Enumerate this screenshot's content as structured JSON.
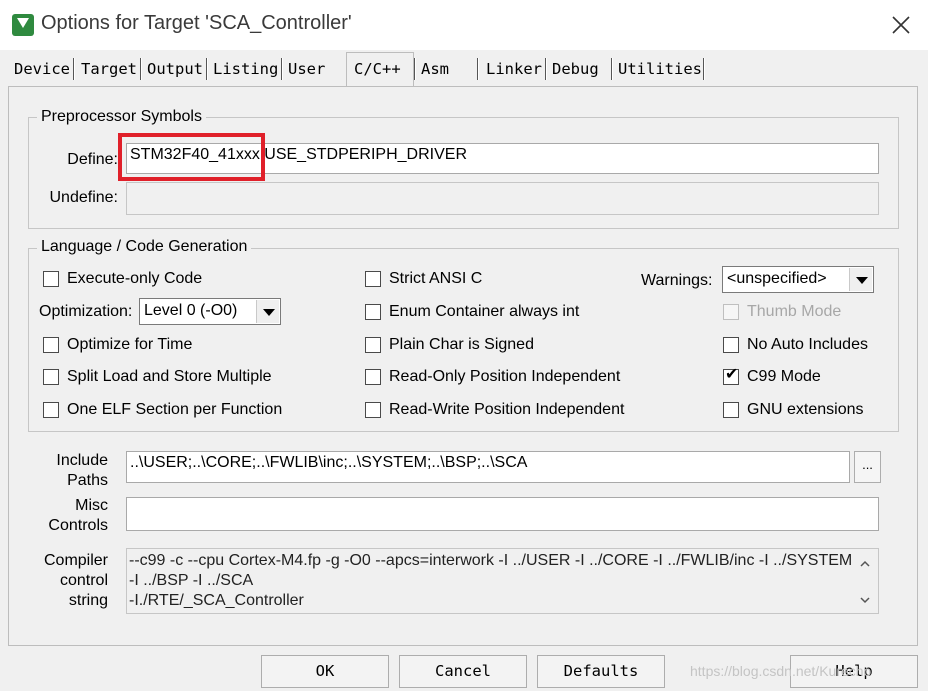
{
  "window": {
    "title": "Options for Target 'SCA_Controller'"
  },
  "tabs": [
    "Device",
    "Target",
    "Output",
    "Listing",
    "User",
    "C/C++",
    "Asm",
    "Linker",
    "Debug",
    "Utilities"
  ],
  "active_tab": "C/C++",
  "preprocessor": {
    "group_title": "Preprocessor Symbols",
    "define_label": "Define:",
    "define_value": "STM32F40_41xxx,USE_STDPERIPH_DRIVER",
    "undefine_label": "Undefine:",
    "undefine_value": ""
  },
  "language": {
    "group_title": "Language / Code Generation",
    "execute_only": {
      "label": "Execute-only Code",
      "checked": false
    },
    "optimization_label": "Optimization:",
    "optimization_value": "Level 0 (-O0)",
    "optimize_time": {
      "label": "Optimize for Time",
      "checked": false
    },
    "split_load": {
      "label": "Split Load and Store Multiple",
      "checked": false
    },
    "one_elf": {
      "label": "One ELF Section per Function",
      "checked": false
    },
    "strict_ansi": {
      "label": "Strict ANSI C",
      "checked": false
    },
    "enum_int": {
      "label": "Enum Container always int",
      "checked": false
    },
    "plain_char": {
      "label": "Plain Char is Signed",
      "checked": false
    },
    "ropi": {
      "label": "Read-Only Position Independent",
      "checked": false
    },
    "rwpi": {
      "label": "Read-Write Position Independent",
      "checked": false
    },
    "warnings_label": "Warnings:",
    "warnings_value": "<unspecified>",
    "thumb_mode": {
      "label": "Thumb Mode",
      "checked": false,
      "disabled": true
    },
    "no_auto_includes": {
      "label": "No Auto Includes",
      "checked": false
    },
    "c99_mode": {
      "label": "C99 Mode",
      "checked": true,
      "mark": "✔"
    },
    "gnu_ext": {
      "label": "GNU extensions",
      "checked": false
    }
  },
  "include": {
    "label_line1": "Include",
    "label_line2": "Paths",
    "value": "..\\USER;..\\CORE;..\\FWLIB\\inc;..\\SYSTEM;..\\BSP;..\\SCA",
    "browse_label": "..."
  },
  "misc": {
    "label_line1": "Misc",
    "label_line2": "Controls",
    "value": ""
  },
  "compiler": {
    "label_line1": "Compiler",
    "label_line2": "control",
    "label_line3": "string",
    "line1": "--c99 -c --cpu Cortex-M4.fp -g -O0 --apcs=interwork -I ../USER -I ../CORE -I ../FWLIB/inc -I ../SYSTEM",
    "line2": "-I ../BSP -I ../SCA",
    "line3": "-I./RTE/_SCA_Controller"
  },
  "buttons": {
    "ok": "OK",
    "cancel": "Cancel",
    "defaults": "Defaults",
    "help": "Help"
  },
  "watermark": "https://blog.csdn.net/Kurecho"
}
